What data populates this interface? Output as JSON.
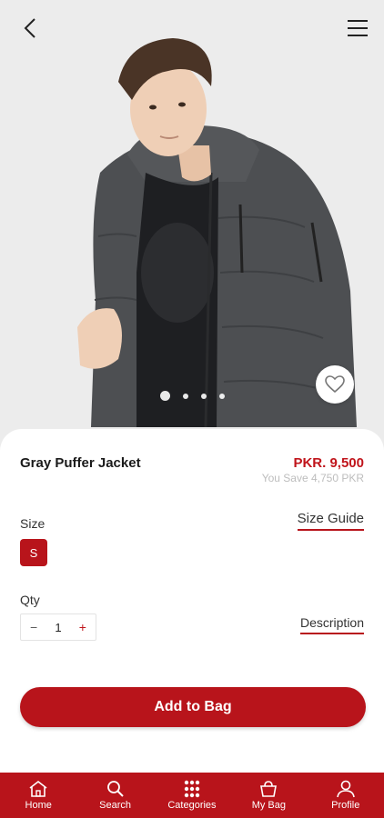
{
  "product": {
    "name": "Gray Puffer Jacket",
    "price": "PKR. 9,500",
    "savings": "You Save 4,750 PKR"
  },
  "options": {
    "size_label": "Size",
    "size_guide_label": "Size Guide",
    "selected_size": "S",
    "qty_label": "Qty",
    "qty_value": "1",
    "qty_minus": "−",
    "qty_plus": "+",
    "description_label": "Description"
  },
  "actions": {
    "add_to_bag": "Add to Bag"
  },
  "gallery": {
    "image_count": 4,
    "active_index": 0
  },
  "nav": {
    "items": [
      {
        "label": "Home",
        "icon": "home-icon"
      },
      {
        "label": "Search",
        "icon": "search-icon"
      },
      {
        "label": "Categories",
        "icon": "grid-icon"
      },
      {
        "label": "My Bag",
        "icon": "bag-icon"
      },
      {
        "label": "Profile",
        "icon": "user-icon"
      }
    ]
  },
  "colors": {
    "brand": "#b8141b",
    "price": "#c0141b"
  }
}
